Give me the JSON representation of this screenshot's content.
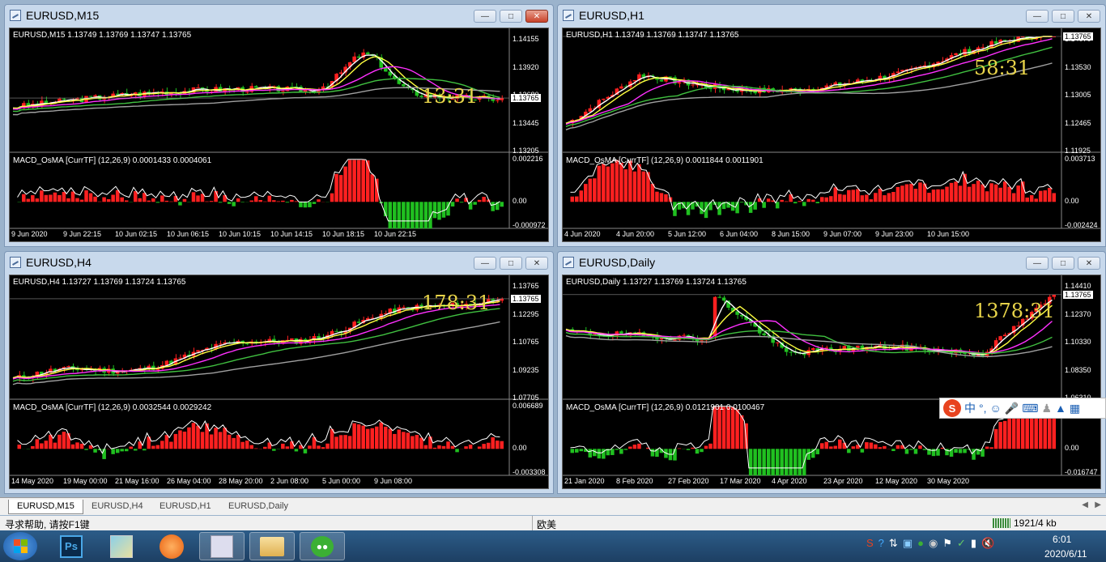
{
  "windows": [
    {
      "id": "m15",
      "title": "EURUSD,M15",
      "symbol_line": "EURUSD,M15  1.13749 1.13769 1.13747 1.13765",
      "timer": "13:31",
      "price_axis": [
        "1.14155",
        "1.13920",
        "1.13680",
        "1.13445",
        "1.13205"
      ],
      "current_price": "1.13765",
      "macd_label": "MACD_OsMA [CurrTF] (12,26,9) 0.0001433 0.0004061",
      "macd_axis": [
        "0.002216",
        "0.00",
        "-0.000972"
      ],
      "time_axis": [
        "9 Jun 2020",
        "9 Jun 22:15",
        "10 Jun 02:15",
        "10 Jun 06:15",
        "10 Jun 10:15",
        "10 Jun 14:15",
        "10 Jun 18:15",
        "10 Jun 22:15"
      ]
    },
    {
      "id": "h1",
      "title": "EURUSD,H1",
      "symbol_line": "EURUSD,H1  1.13749 1.13769 1.13747 1.13765",
      "timer": "58:31",
      "price_axis": [
        "1.14070",
        "1.13530",
        "1.13005",
        "1.12465",
        "1.11925"
      ],
      "current_price": "1.13765",
      "macd_label": "MACD_OsMA [CurrTF] (12,26,9) 0.0011844 0.0011901",
      "macd_axis": [
        "0.003713",
        "0.00",
        "-0.002424"
      ],
      "time_axis": [
        "4 Jun 2020",
        "4 Jun 20:00",
        "5 Jun 12:00",
        "6 Jun 04:00",
        "8 Jun 15:00",
        "9 Jun 07:00",
        "9 Jun 23:00",
        "10 Jun 15:00"
      ]
    },
    {
      "id": "h4",
      "title": "EURUSD,H4",
      "symbol_line": "EURUSD,H4  1.13727 1.13769 1.13724 1.13765",
      "timer": "178:31",
      "price_axis": [
        "1.13765",
        "1.12295",
        "1.10765",
        "1.09235",
        "1.07705"
      ],
      "current_price": "1.13765",
      "macd_label": "MACD_OsMA [CurrTF] (12,26,9) 0.0032544 0.0029242",
      "macd_axis": [
        "0.006689",
        "0.00",
        "-0.003308"
      ],
      "time_axis": [
        "14 May 2020",
        "19 May 00:00",
        "21 May 16:00",
        "26 May 04:00",
        "28 May 20:00",
        "2 Jun 08:00",
        "5 Jun 00:00",
        "9 Jun 08:00"
      ]
    },
    {
      "id": "d1",
      "title": "EURUSD,Daily",
      "symbol_line": "EURUSD,Daily  1.13727 1.13769 1.13724 1.13765",
      "timer": "1378:31",
      "price_axis": [
        "1.14410",
        "1.12370",
        "1.10330",
        "1.08350",
        "1.06310"
      ],
      "current_price": "1.13765",
      "macd_label": "MACD_OsMA [CurrTF] (12,26,9) 0.0121901 0.0100467",
      "macd_axis": [
        "0.00",
        "-0.016747"
      ],
      "time_axis": [
        "21 Jan 2020",
        "8 Feb 2020",
        "27 Feb 2020",
        "17 Mar 2020",
        "4 Apr 2020",
        "23 Apr 2020",
        "12 May 2020",
        "30 May 2020"
      ]
    }
  ],
  "tabs": [
    "EURUSD,M15",
    "EURUSD,H4",
    "EURUSD,H1",
    "EURUSD,Daily"
  ],
  "status": {
    "help": "寻求帮助, 请按F1键",
    "profile": "欧美",
    "traffic": "1921/4 kb"
  },
  "clock": {
    "time": "6:01",
    "date": "2020/6/11"
  },
  "ime": {
    "lang": "中"
  },
  "colors": {
    "bull": "#ff2020",
    "bear": "#20c020",
    "ma_white": "#ffffff",
    "ma_yellow": "#ffff40",
    "ma_magenta": "#ff30ff",
    "ma_green": "#40c040",
    "ma_gray": "#a0a0a0",
    "timer": "#e8d44a"
  }
}
